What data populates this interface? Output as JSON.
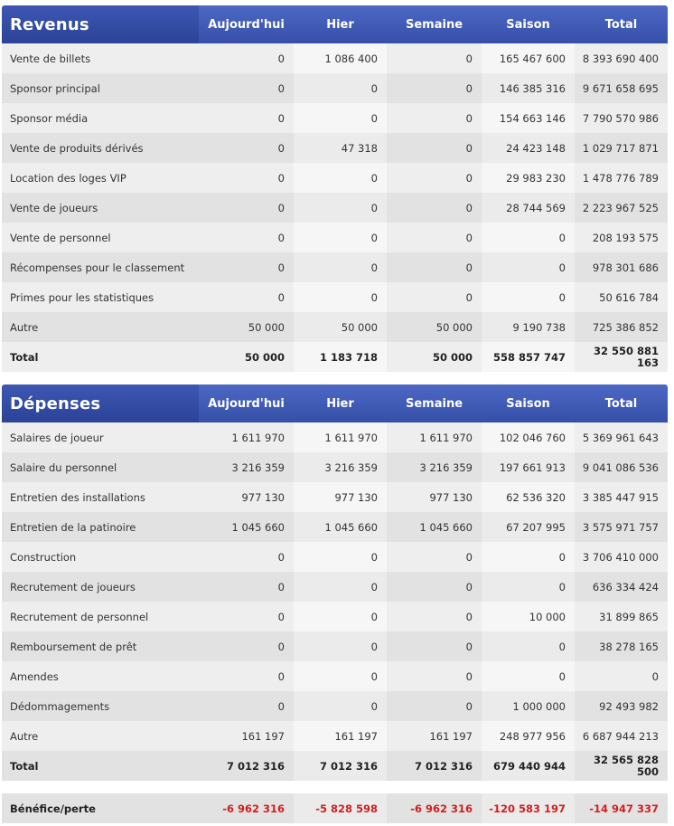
{
  "columns": [
    "Aujourd'hui",
    "Hier",
    "Semaine",
    "Saison",
    "Total"
  ],
  "revenus": {
    "title": "Revenus",
    "rows": [
      {
        "label": "Vente de billets",
        "values": [
          "0",
          "1 086 400",
          "0",
          "165 467 600",
          "8 393 690 400"
        ]
      },
      {
        "label": "Sponsor principal",
        "values": [
          "0",
          "0",
          "0",
          "146 385 316",
          "9 671 658 695"
        ]
      },
      {
        "label": "Sponsor média",
        "values": [
          "0",
          "0",
          "0",
          "154 663 146",
          "7 790 570 986"
        ]
      },
      {
        "label": "Vente de produits dérivés",
        "values": [
          "0",
          "47 318",
          "0",
          "24 423 148",
          "1 029 717 871"
        ]
      },
      {
        "label": "Location des loges VIP",
        "values": [
          "0",
          "0",
          "0",
          "29 983 230",
          "1 478 776 789"
        ]
      },
      {
        "label": "Vente de joueurs",
        "values": [
          "0",
          "0",
          "0",
          "28 744 569",
          "2 223 967 525"
        ]
      },
      {
        "label": "Vente de personnel",
        "values": [
          "0",
          "0",
          "0",
          "0",
          "208 193 575"
        ]
      },
      {
        "label": "Récompenses pour le classement",
        "values": [
          "0",
          "0",
          "0",
          "0",
          "978 301 686"
        ]
      },
      {
        "label": "Primes pour les statistiques",
        "values": [
          "0",
          "0",
          "0",
          "0",
          "50 616 784"
        ]
      },
      {
        "label": "Autre",
        "values": [
          "50 000",
          "50 000",
          "50 000",
          "9 190 738",
          "725 386 852"
        ]
      }
    ],
    "total": {
      "label": "Total",
      "values": [
        "50 000",
        "1 183 718",
        "50 000",
        "558 857 747",
        "32 550 881 163"
      ]
    }
  },
  "depenses": {
    "title": "Dépenses",
    "rows": [
      {
        "label": "Salaires de joueur",
        "values": [
          "1 611 970",
          "1 611 970",
          "1 611 970",
          "102 046 760",
          "5 369 961 643"
        ]
      },
      {
        "label": "Salaire du personnel",
        "values": [
          "3 216 359",
          "3 216 359",
          "3 216 359",
          "197 661 913",
          "9 041 086 536"
        ]
      },
      {
        "label": "Entretien des installations",
        "values": [
          "977 130",
          "977 130",
          "977 130",
          "62 536 320",
          "3 385 447 915"
        ]
      },
      {
        "label": "Entretien de la patinoire",
        "values": [
          "1 045 660",
          "1 045 660",
          "1 045 660",
          "67 207 995",
          "3 575 971 757"
        ]
      },
      {
        "label": "Construction",
        "values": [
          "0",
          "0",
          "0",
          "0",
          "3 706 410 000"
        ]
      },
      {
        "label": "Recrutement de joueurs",
        "values": [
          "0",
          "0",
          "0",
          "0",
          "636 334 424"
        ]
      },
      {
        "label": "Recrutement de personnel",
        "values": [
          "0",
          "0",
          "0",
          "10 000",
          "31 899 865"
        ]
      },
      {
        "label": "Remboursement de prêt",
        "values": [
          "0",
          "0",
          "0",
          "0",
          "38 278 165"
        ]
      },
      {
        "label": "Amendes",
        "values": [
          "0",
          "0",
          "0",
          "0",
          "0"
        ]
      },
      {
        "label": "Dédommagements",
        "values": [
          "0",
          "0",
          "0",
          "1 000 000",
          "92 493 982"
        ]
      },
      {
        "label": "Autre",
        "values": [
          "161 197",
          "161 197",
          "161 197",
          "248 977 956",
          "6 687 944 213"
        ]
      }
    ],
    "total": {
      "label": "Total",
      "values": [
        "7 012 316",
        "7 012 316",
        "7 012 316",
        "679 440 944",
        "32 565 828 500"
      ]
    }
  },
  "profit": {
    "label": "Bénéfice/perte",
    "values": [
      "-6 962 316",
      "-5 828 598",
      "-6 962 316",
      "-120 583 197",
      "-14 947 337"
    ]
  },
  "colors": {
    "header": "#3a55b0",
    "negative": "#d11f1f"
  }
}
